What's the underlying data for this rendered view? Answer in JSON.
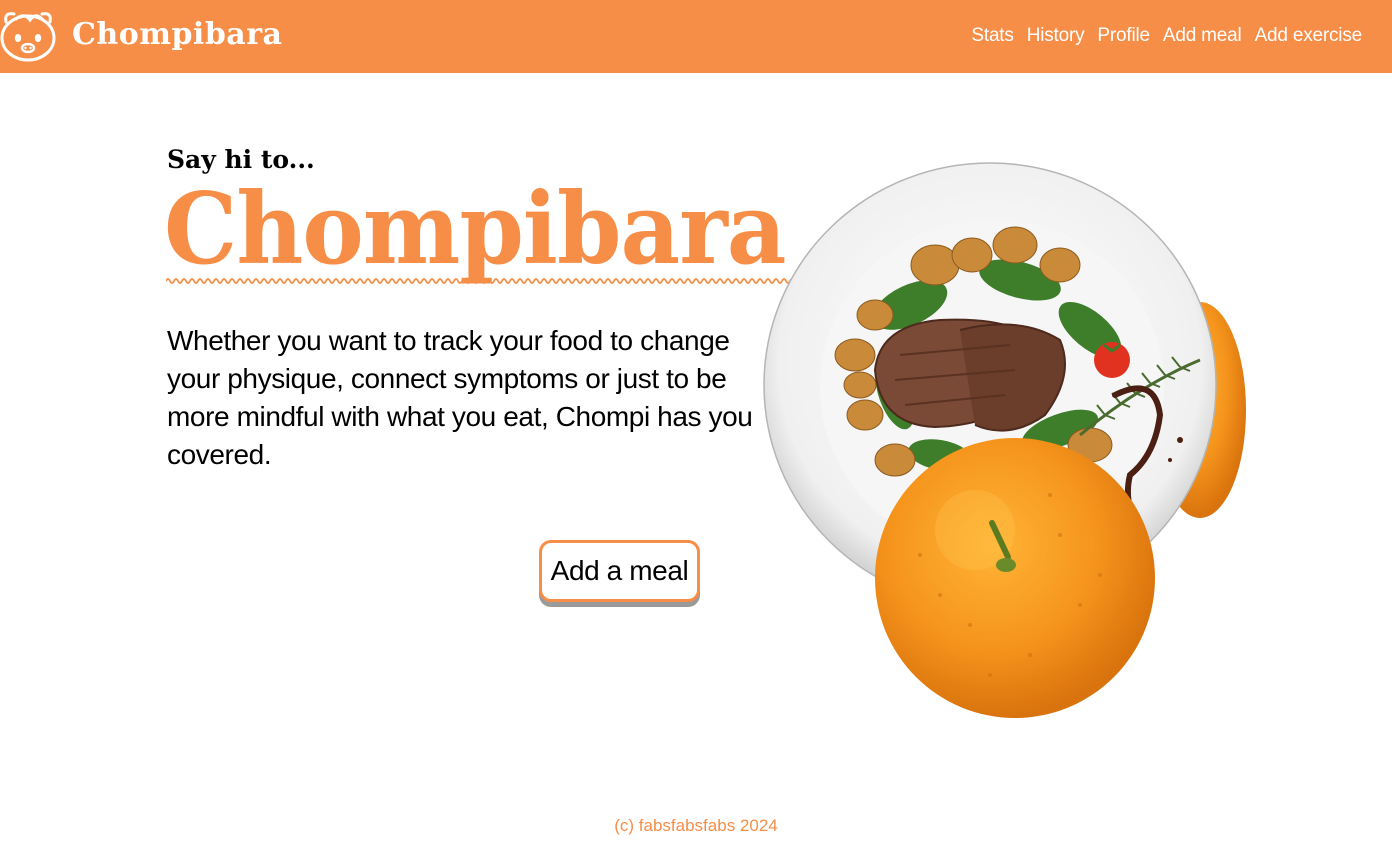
{
  "header": {
    "brand": "Chompibara",
    "logo_icon": "capybara-icon",
    "nav": [
      "Stats",
      "History",
      "Profile",
      "Add meal",
      "Add exercise"
    ]
  },
  "hero": {
    "greeting": "Say hi to...",
    "title": "Chompibara",
    "tagline": "Whether you want to track your food to change your physique, connect symptoms or just to be more mindful with what you eat, Chompi has you covered.",
    "cta_label": "Add a meal",
    "image_icon": "food-plate-and-orange-image"
  },
  "footer": {
    "copyright": "(c) fabsfabsfabs 2024"
  },
  "colors": {
    "accent": "#f68e48",
    "background": "#ffffff",
    "text": "#000000"
  }
}
